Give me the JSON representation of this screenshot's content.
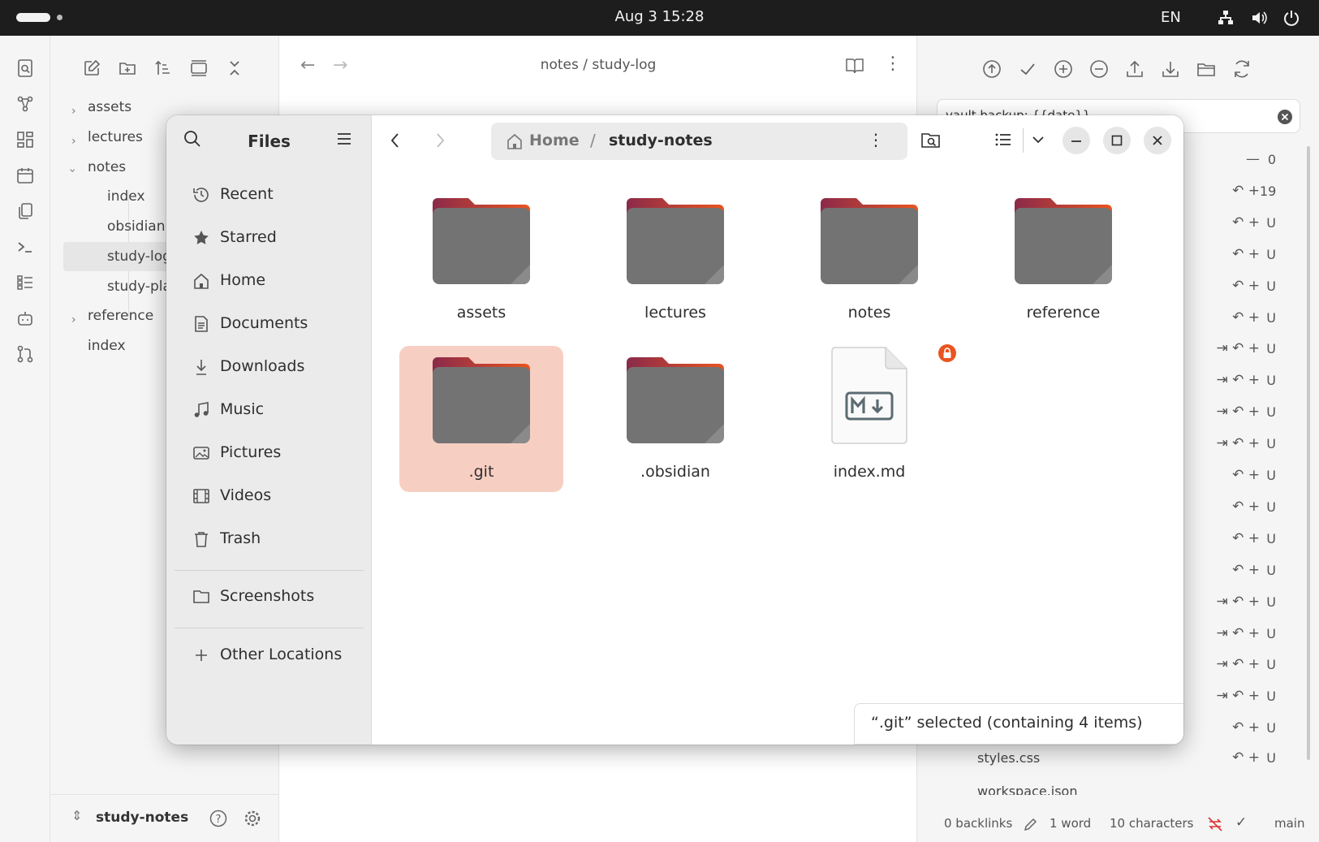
{
  "topbar": {
    "clock": "Aug 3  15:28",
    "language": "EN",
    "icons": [
      "network-icon",
      "volume-icon",
      "power-icon"
    ]
  },
  "obsidian": {
    "ribbon_icons": [
      "search-icon",
      "graph-icon",
      "canvas-icon",
      "calendar-icon",
      "copy-icon",
      "terminal-icon",
      "outline-icon",
      "bot-icon",
      "git-icon"
    ],
    "filetree_toolbar": [
      "new-note-icon",
      "new-folder-icon",
      "sort-icon",
      "collapse-view-icon",
      "collapse-all-icon"
    ],
    "tree": [
      {
        "label": "assets",
        "type": "folder",
        "expanded": false
      },
      {
        "label": "lectures",
        "type": "folder",
        "expanded": false
      },
      {
        "label": "notes",
        "type": "folder",
        "expanded": true
      },
      {
        "label": "index",
        "type": "file"
      },
      {
        "label": "obsidian",
        "type": "file"
      },
      {
        "label": "study-log",
        "type": "file",
        "selected": true
      },
      {
        "label": "study-pla",
        "type": "file"
      },
      {
        "label": "reference",
        "type": "folder",
        "expanded": false
      },
      {
        "label": "index",
        "type": "file"
      }
    ],
    "vault_name": "study-notes",
    "editor": {
      "breadcrumb": "notes / study-log"
    },
    "git": {
      "commit_message": "vault backup: {{date}}",
      "first_count": "0",
      "second_count": "19",
      "status_letter": "U",
      "visible_files": [
        "styles.css",
        "styles.css",
        "workspace.json"
      ]
    },
    "statusbar": {
      "backlinks": "0 backlinks",
      "words": "1 word",
      "characters": "10 characters",
      "branch": "main"
    }
  },
  "files": {
    "title": "Files",
    "places": [
      {
        "label": "Recent",
        "icon": "recent-icon"
      },
      {
        "label": "Starred",
        "icon": "star-icon"
      },
      {
        "label": "Home",
        "icon": "home-icon"
      },
      {
        "label": "Documents",
        "icon": "documents-icon"
      },
      {
        "label": "Downloads",
        "icon": "downloads-icon"
      },
      {
        "label": "Music",
        "icon": "music-icon"
      },
      {
        "label": "Pictures",
        "icon": "pictures-icon"
      },
      {
        "label": "Videos",
        "icon": "videos-icon"
      },
      {
        "label": "Trash",
        "icon": "trash-icon"
      }
    ],
    "bookmarks": [
      {
        "label": "Screenshots",
        "icon": "folder-icon"
      }
    ],
    "other_locations": "Other Locations",
    "path": {
      "home": "Home",
      "separator": "/",
      "current": "study-notes"
    },
    "items": [
      {
        "label": "assets",
        "kind": "folder"
      },
      {
        "label": "lectures",
        "kind": "folder"
      },
      {
        "label": "notes",
        "kind": "folder"
      },
      {
        "label": "reference",
        "kind": "folder"
      },
      {
        "label": ".git",
        "kind": "folder",
        "selected": true
      },
      {
        "label": ".obsidian",
        "kind": "folder"
      },
      {
        "label": "index.md",
        "kind": "markdown-file",
        "locked": true
      }
    ],
    "status": "“.git” selected  (containing 4 items)"
  },
  "colors": {
    "accent": "#e95420",
    "folder_body": "#737373",
    "folder_tab_start": "#8a2a4a",
    "folder_tab_end": "#e95420",
    "selection": "#f7cfc2",
    "topbar": "#1d1d1d"
  }
}
